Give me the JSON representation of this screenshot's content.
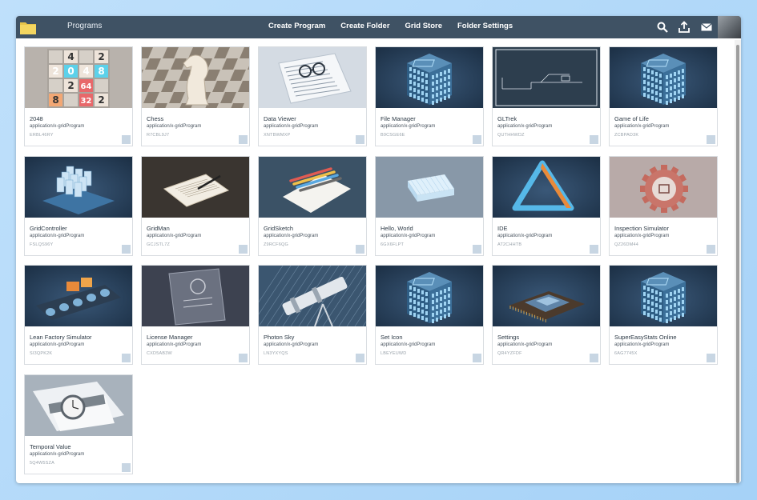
{
  "header": {
    "title": "Programs",
    "nav": [
      "Create Program",
      "Create Folder",
      "Grid Store",
      "Folder Settings"
    ],
    "bg_color": "#3f5264"
  },
  "toolbar_icons": [
    "search-icon",
    "upload-icon",
    "mail-icon"
  ],
  "programs": [
    {
      "name": "2048",
      "type": "application/x-gridProgram",
      "id": "ERBL46RY",
      "thumb": "2048"
    },
    {
      "name": "Chess",
      "type": "application/x-gridProgram",
      "id": "R7CBL9J7",
      "thumb": "chess"
    },
    {
      "name": "Data Viewer",
      "type": "application/x-gridProgram",
      "id": "XNTBWMXP",
      "thumb": "dataviewer"
    },
    {
      "name": "File Manager",
      "type": "application/x-gridProgram",
      "id": "B9CSGE6E",
      "thumb": "cube"
    },
    {
      "name": "GLTrek",
      "type": "application/x-gridProgram",
      "id": "QUTHHWDZ",
      "thumb": "gltrek"
    },
    {
      "name": "Game of Life",
      "type": "application/x-gridProgram",
      "id": "ZCBPAD3K",
      "thumb": "cube"
    },
    {
      "name": "GridController",
      "type": "application/x-gridProgram",
      "id": "FSLQS96Y",
      "thumb": "gridcontroller"
    },
    {
      "name": "GridMan",
      "type": "application/x-gridProgram",
      "id": "GCJSTL7Z",
      "thumb": "gridman"
    },
    {
      "name": "GridSketch",
      "type": "application/x-gridProgram",
      "id": "Z9RCF6QG",
      "thumb": "gridsketch"
    },
    {
      "name": "Hello, World",
      "type": "application/x-gridProgram",
      "id": "6GX6FLPT",
      "thumb": "hello"
    },
    {
      "name": "IDE",
      "type": "application/x-gridProgram",
      "id": "AT2CHHTB",
      "thumb": "ide"
    },
    {
      "name": "Inspection Simulator",
      "type": "application/x-gridProgram",
      "id": "QZ26DM44",
      "thumb": "inspection"
    },
    {
      "name": "Lean Factory Simulator",
      "type": "application/x-gridProgram",
      "id": "SI3QPK2K",
      "thumb": "factory"
    },
    {
      "name": "License Manager",
      "type": "application/x-gridProgram",
      "id": "CXD5AB3W",
      "thumb": "license"
    },
    {
      "name": "Photon Sky",
      "type": "application/x-gridProgram",
      "id": "LN3YXYQS",
      "thumb": "photon"
    },
    {
      "name": "Set Icon",
      "type": "application/x-gridProgram",
      "id": "LBEYEUWD",
      "thumb": "cube"
    },
    {
      "name": "Settings",
      "type": "application/x-gridProgram",
      "id": "QR4YZFDF",
      "thumb": "settings"
    },
    {
      "name": "SuperEasyStats Online",
      "type": "application/x-gridProgram",
      "id": "6AG7745X",
      "thumb": "cube"
    },
    {
      "name": "Temporal Value",
      "type": "application/x-gridProgram",
      "id": "5Q4W5SZA",
      "thumb": "watch"
    }
  ],
  "tile2048": {
    "rows": [
      [
        "",
        "4",
        "",
        "2"
      ],
      [
        "2",
        "0",
        "4",
        "8"
      ],
      [
        "",
        "2",
        "64",
        ""
      ],
      [
        "8",
        "",
        "32",
        "2"
      ]
    ]
  }
}
